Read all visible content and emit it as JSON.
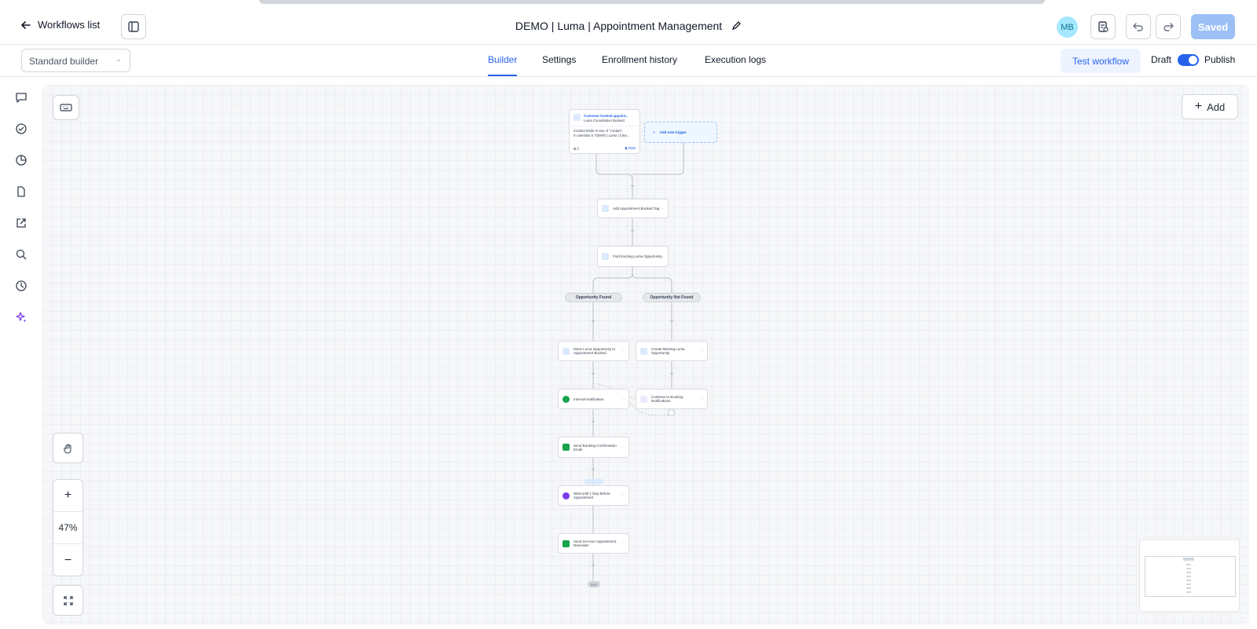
{
  "header": {
    "back_label": "Workflows list",
    "title": "DEMO | Luma | Appointment Management",
    "avatar": "MB",
    "saved_label": "Saved"
  },
  "subbar": {
    "builder_select": "Standard builder",
    "tabs": [
      {
        "label": "Builder",
        "active": true
      },
      {
        "label": "Settings",
        "active": false
      },
      {
        "label": "Enrollment history",
        "active": false
      },
      {
        "label": "Execution logs",
        "active": false
      }
    ],
    "test_label": "Test workflow",
    "draft_label": "Draft",
    "publish_label": "Publish",
    "publish_on": true
  },
  "sidebar": {
    "icons": [
      "chat-icon",
      "check-circle-icon",
      "pie-chart-icon",
      "file-icon",
      "external-link-icon",
      "search-icon",
      "clock-icon",
      "sparkles-icon"
    ]
  },
  "canvas": {
    "add_label": "Add",
    "zoom": "47%",
    "trigger": {
      "title": "Customer booked appoint...",
      "subtitle": "Luma Consultation Booked",
      "cond1": "Contact Mode is any of \"contact\"",
      "cond2": "In calendar is \"DEMO | Luma | Clea...",
      "stats": "Stats"
    },
    "add_trigger": "Add new trigger",
    "nodes": {
      "add_tag": "Add Appointment Booked Tag",
      "find_opp": "Find Existing Luma Opportunity",
      "branch_found": "Opportunity Found",
      "branch_not_found": "Opportunity Not Found",
      "move_opp": "Move Luma Opportunity to Appointment Booked",
      "create_opp": "Create Missing Luma Opportunity",
      "internal_notif": "Internal Notification",
      "continue_notif": "Continue to Booking Notifications",
      "send_confirm": "Send Booking Confirmation Email",
      "wait": "Wait Until 1 Day Before Appointment",
      "send_reminder": "Send 24-Hour Appointment Reminder",
      "end": "END"
    }
  },
  "colors": {
    "accent": "#2563eb",
    "saved_button": "#9cc0f5",
    "avatar": "#a5e8ff",
    "sidebar_active": "#7c3aed"
  }
}
